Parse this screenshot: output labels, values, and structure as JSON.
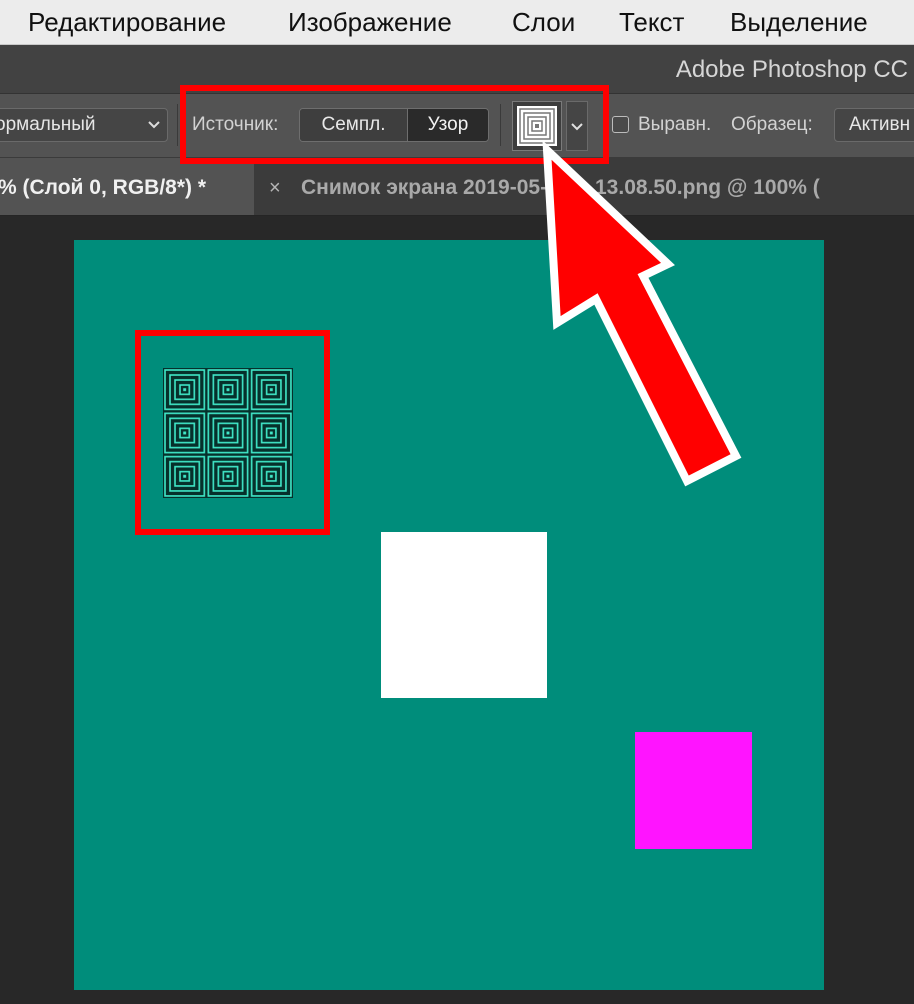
{
  "menu": {
    "items": [
      "Редактирование",
      "Изображение",
      "Слои",
      "Текст",
      "Выделение"
    ]
  },
  "titlebar": {
    "app_title": "Adobe Photoshop CC"
  },
  "options": {
    "blend_mode": "ормальный",
    "source_label": "Источник:",
    "source_sampled": "Семпл.",
    "source_pattern": "Узор",
    "align_label": "Выравн.",
    "sample_label": "Образец:",
    "sample_value": "Активн"
  },
  "tabs": {
    "active_title": "% (Слой 0, RGB/8*) *",
    "inactive_close": "×",
    "inactive_title": "Снимок экрана 2019-05-19 в 13.08.50.png @ 100% ("
  },
  "colors": {
    "canvas": "#008d7b",
    "highlight": "#ff0000",
    "magenta": "#ff14ff",
    "pattern_line": "#40e8c8"
  },
  "icons": {
    "pattern_preview": "concentric-squares-icon",
    "dropdown": "chevron-down-icon",
    "close": "close-icon"
  }
}
